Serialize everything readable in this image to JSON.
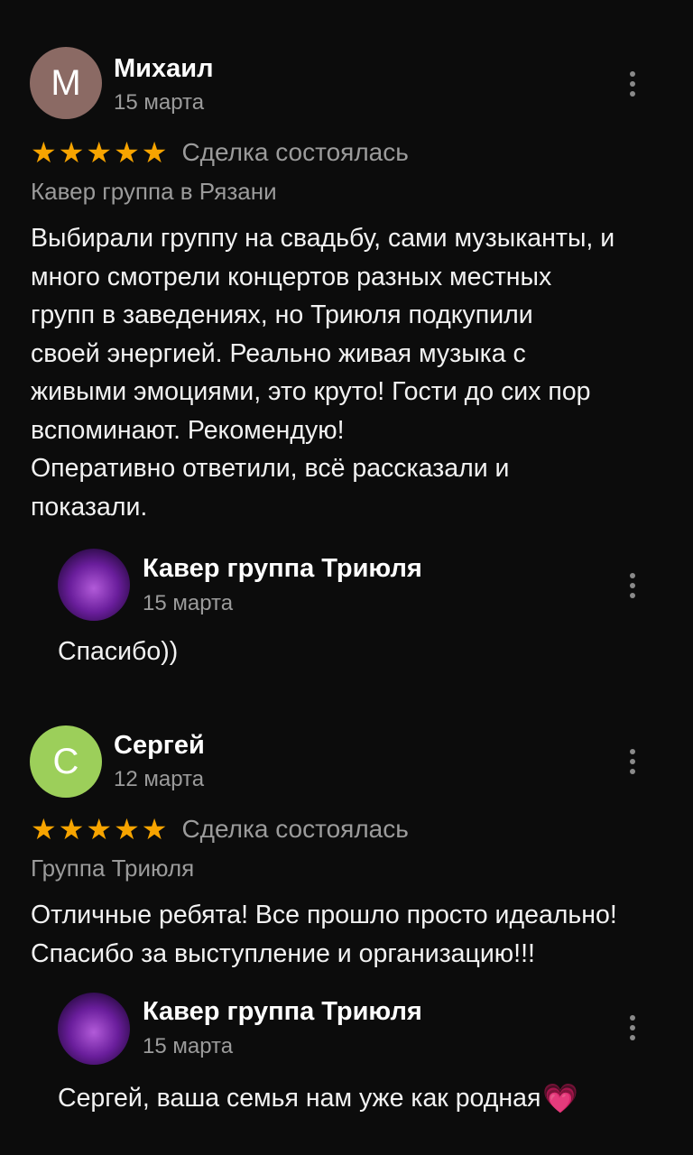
{
  "reviews": [
    {
      "author": "Михаил",
      "avatar_letter": "М",
      "avatar_color": "#8b6a64",
      "date": "15 марта",
      "rating": 5,
      "deal_status": "Сделка состоялась",
      "service": "Кавер группа в Рязани",
      "text": "Выбирали группу на свадьбу, сами музыканты, и\nмного смотрели концертов разных местных\nгрупп в заведениях, но Триюля подкупили\nсвоей энергией. Реально живая музыка с\nживыми эмоциями, это круто! Гости до сих пор\nвспоминают. Рекомендую!\nОперативно ответили, всё рассказали и\nпоказали.",
      "reply": {
        "author": "Кавер группа Триюля",
        "date": "15 марта",
        "text": "Спасибо))"
      }
    },
    {
      "author": "Сергей",
      "avatar_letter": "С",
      "avatar_color": "#9ccf5a",
      "date": "12 марта",
      "rating": 5,
      "deal_status": "Сделка состоялась",
      "service": "Группа Триюля",
      "text": "Отличные ребята! Все прошло просто идеально!\nСпасибо за выступление и организацию!!!",
      "reply": {
        "author": "Кавер группа Триюля",
        "date": "15 марта",
        "text": "Сергей, ваша семья нам уже как родная",
        "emoji": "💗"
      }
    }
  ],
  "icons": {
    "star": "star-icon",
    "more": "more-vertical-icon"
  },
  "colors": {
    "background": "#0c0c0c",
    "star": "#f7a400",
    "muted": "#9b9b9b"
  }
}
